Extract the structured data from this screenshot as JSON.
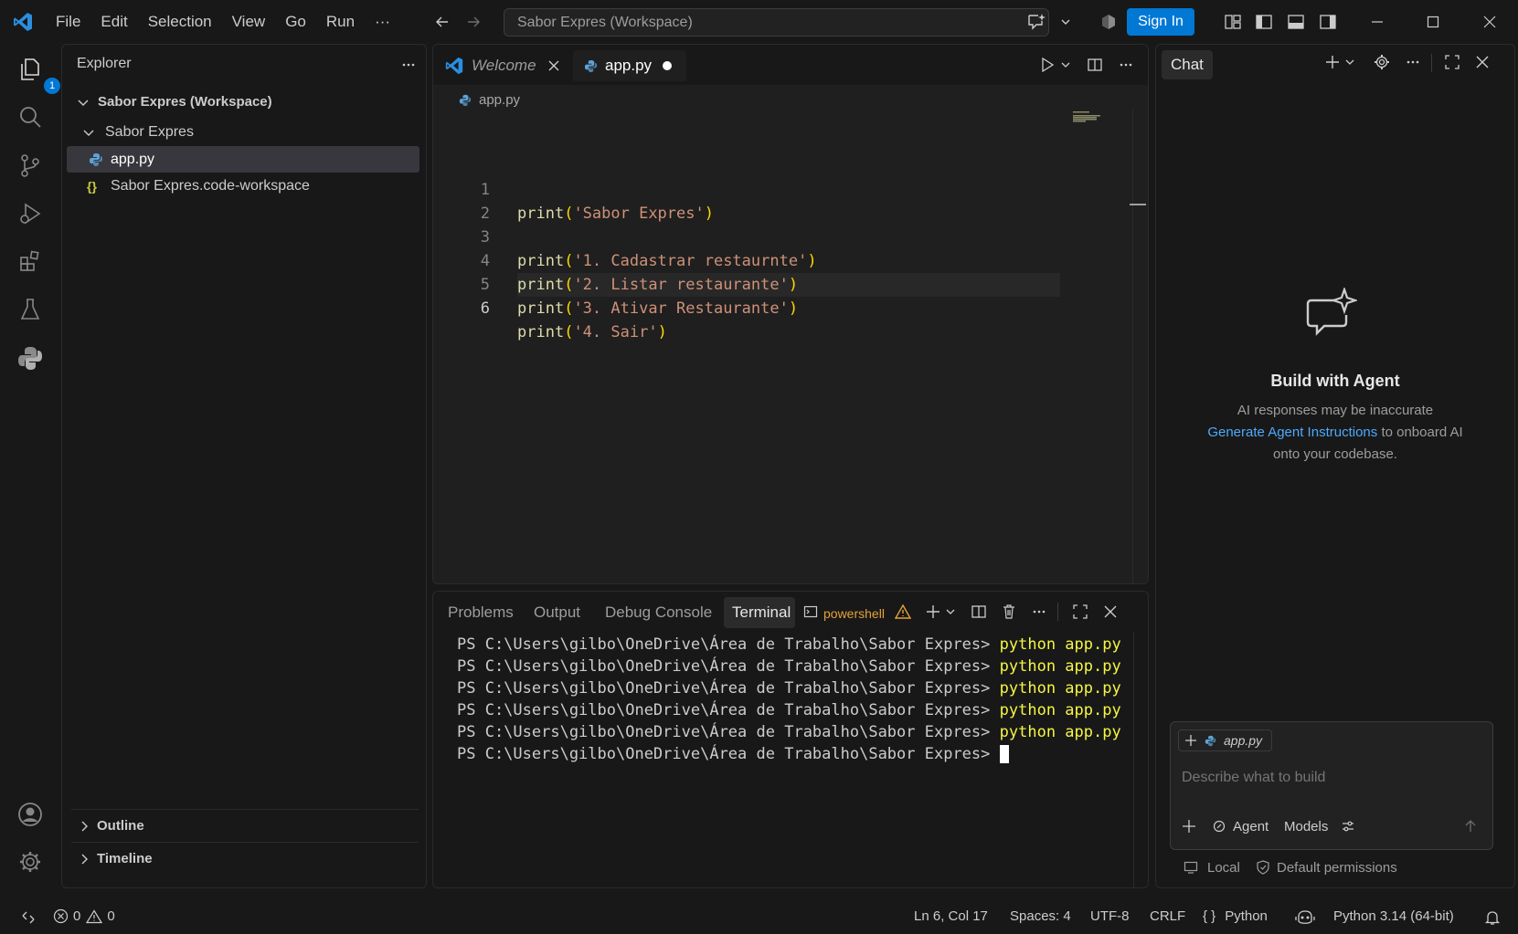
{
  "menu": [
    "File",
    "Edit",
    "Selection",
    "View",
    "Go",
    "Run",
    "···"
  ],
  "command_center": "Sabor Expres (Workspace)",
  "sign_in": "Sign In",
  "activity_badge": "1",
  "explorer": {
    "title": "Explorer",
    "workspace": "Sabor Expres (Workspace)",
    "folder": "Sabor Expres",
    "files": [
      "app.py",
      "Sabor Expres.code-workspace"
    ],
    "file_icon_py": "python-file-icon",
    "file_icon_json": "{}",
    "sections": [
      "Outline",
      "Timeline"
    ]
  },
  "editor": {
    "tabs": [
      {
        "label": "Welcome"
      },
      {
        "label": "app.py"
      }
    ],
    "breadcrumb": "app.py",
    "line_numbers": [
      "1",
      "2",
      "3",
      "4",
      "5",
      "6"
    ],
    "lines": [
      {
        "fn": "print",
        "str": "'Sabor Expres'"
      },
      {
        "fn": "",
        "str": ""
      },
      {
        "fn": "print",
        "str": "'1. Cadastrar restaurnte'"
      },
      {
        "fn": "print",
        "str": "'2. Listar restaurante'"
      },
      {
        "fn": "print",
        "str": "'3. Ativar Restaurante'"
      },
      {
        "fn": "print",
        "str": "'4. Sair'"
      }
    ]
  },
  "panel": {
    "tabs": [
      "Problems",
      "Output",
      "Debug Console",
      "Terminal"
    ],
    "terminal_name": "powershell",
    "prompt": "PS C:\\Users\\gilbo\\OneDrive\\Área de Trabalho\\Sabor Expres>",
    "command": "python app.py",
    "history_count_lines": [
      "python app.py",
      "python app.py",
      "python app.py",
      "python app.py",
      "python app.py",
      ""
    ]
  },
  "chat": {
    "title": "Chat",
    "heading": "Build with Agent",
    "disclaimer": "AI responses may be inaccurate",
    "link": "Generate Agent Instructions",
    "link_suffix": "to onboard AI",
    "line3": "onto your codebase.",
    "context_chip": "app.py",
    "placeholder": "Describe what to build",
    "agent": "Agent",
    "models": "Models",
    "local": "Local",
    "permissions": "Default permissions"
  },
  "status": {
    "errors": "0",
    "warnings": "0",
    "position": "Ln 6, Col 17",
    "spaces": "Spaces: 4",
    "encoding": "UTF-8",
    "eol": "CRLF",
    "language": "Python",
    "language_icon": "{ }",
    "interpreter": "Python 3.14 (64-bit)"
  },
  "colors": {
    "accent": "#0078d4",
    "background": "#181818",
    "editor": "#1f1f1f"
  }
}
